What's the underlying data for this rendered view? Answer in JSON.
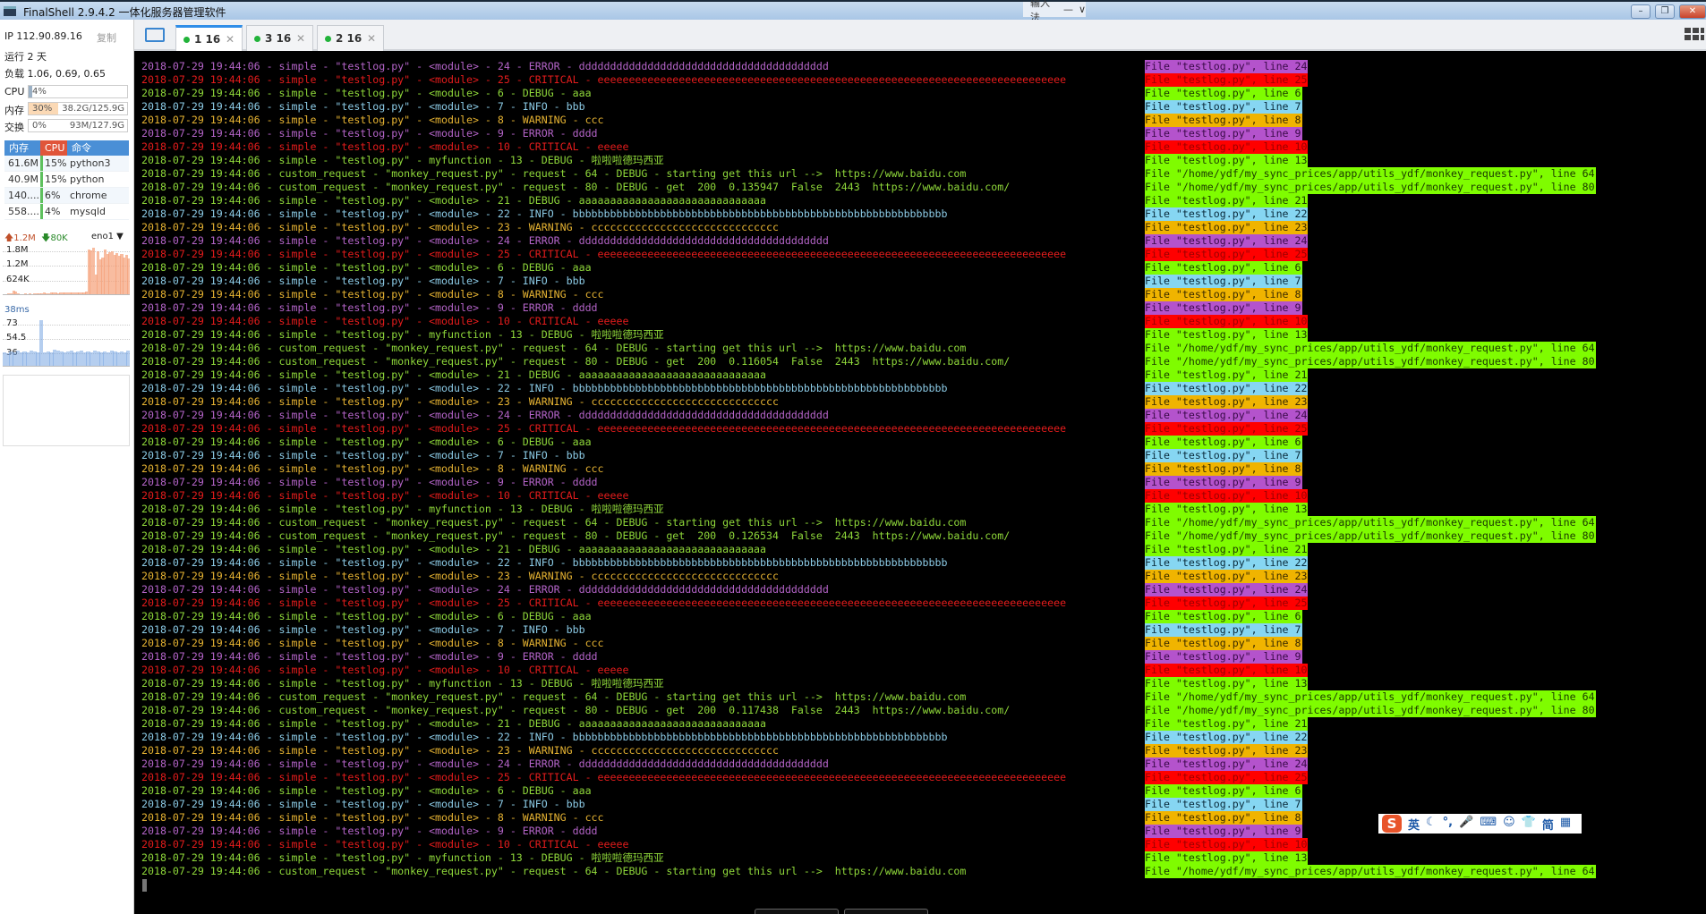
{
  "window": {
    "title": "FinalShell 2.9.4.2 一体化服务器管理软件",
    "controls": [
      "minimize",
      "restore",
      "close"
    ]
  },
  "floatbar": {
    "items": [
      "输入法",
      "—",
      "∨"
    ]
  },
  "tabs": [
    {
      "label": "1 16",
      "active": true,
      "status": "connected",
      "status_color": "#22b33a"
    },
    {
      "label": "3 16",
      "active": false,
      "status": "connected",
      "status_color": "#22b33a"
    },
    {
      "label": "2 16",
      "active": false,
      "status": "connected",
      "status_color": "#22b33a"
    }
  ],
  "sidebar": {
    "ip": "IP 112.90.89.16",
    "copy_label": "复制",
    "uptime": "运行 2 天",
    "load": "负载 1.06, 0.69, 0.65",
    "cpu": {
      "label": "CPU",
      "percent": "4%",
      "value": 4
    },
    "mem": {
      "label": "内存",
      "percent": "30%",
      "value": 30,
      "amount": "38.2G/125.9G"
    },
    "swap": {
      "label": "交换",
      "percent": "0%",
      "value": 0,
      "amount": "93M/127.9G"
    },
    "process_headers": [
      "内存",
      "CPU",
      "命令"
    ],
    "processes": [
      {
        "mem": "61.6M",
        "cpu": "15%",
        "cmd": "python3"
      },
      {
        "mem": "40.9M",
        "cpu": "15%",
        "cmd": "python"
      },
      {
        "mem": "140....",
        "cpu": "6%",
        "cmd": "chrome"
      },
      {
        "mem": "558....",
        "cpu": "4%",
        "cmd": "mysqld"
      }
    ],
    "network": {
      "up": "1.2M",
      "down": "80K",
      "interface": "eno1",
      "labels": [
        "1.8M",
        "1.2M",
        "624K"
      ],
      "history": [
        0,
        0,
        1,
        2,
        8,
        6,
        2,
        0,
        0,
        1,
        0,
        1,
        0,
        2,
        1,
        1,
        2,
        3,
        1,
        2,
        3,
        4,
        3,
        2,
        3,
        4,
        3,
        4,
        4,
        3,
        3,
        4,
        3,
        3,
        4,
        5,
        90,
        88,
        92,
        40,
        86,
        70,
        74,
        90,
        80,
        84,
        86,
        78,
        82,
        76,
        80,
        74,
        78,
        72
      ]
    },
    "ping": {
      "current": "38ms",
      "labels": [
        "73",
        "54.5",
        "36"
      ],
      "history": [
        36,
        35,
        37,
        36,
        38,
        36,
        37,
        36,
        38,
        37,
        36,
        75,
        36,
        37,
        36,
        39,
        38,
        37,
        36,
        37,
        38,
        36,
        37,
        38,
        36,
        37,
        36,
        38,
        37,
        36,
        37,
        36,
        38,
        37,
        36,
        37,
        36,
        38
      ]
    }
  },
  "levels": {
    "DEBUG": {
      "fg": "#8fd83a",
      "badge": "#7ffc00",
      "badge_fg": "#1a3a00"
    },
    "INFO": {
      "fg": "#8ccbe6",
      "badge": "#86d6f2",
      "badge_fg": "#0a2a3a"
    },
    "WARNING": {
      "fg": "#e6b332",
      "badge": "#f0b400",
      "badge_fg": "#3a2a00"
    },
    "ERROR": {
      "fg": "#b464c8",
      "badge": "#b453cc",
      "badge_fg": "#3a0a48"
    },
    "CRITICAL": {
      "fg": "#e41c1c",
      "badge": "#ff0000",
      "badge_fg": "#9a0000"
    }
  },
  "terminal": {
    "lines": [
      {
        "lvl": "ERROR",
        "text": "2018-07-29 19:44:06 - simple - \"testlog.py\" - <module> - 24 - ERROR - dddddddddddddddddddddddddddddddddddddddd",
        "file": "File \"testlog.py\", line 24"
      },
      {
        "lvl": "CRITICAL",
        "text": "2018-07-29 19:44:06 - simple - \"testlog.py\" - <module> - 25 - CRITICAL - eeeeeeeeeeeeeeeeeeeeeeeeeeeeeeeeeeeeeeeeeeeeeeeeeeeeeeeeeeeeeeeeeeeeeeeeeee",
        "file": "File \"testlog.py\", line 25"
      },
      {
        "lvl": "DEBUG",
        "text": "2018-07-29 19:44:06 - simple - \"testlog.py\" - <module> - 6 - DEBUG - aaa",
        "file": "File \"testlog.py\", line 6"
      },
      {
        "lvl": "INFO",
        "text": "2018-07-29 19:44:06 - simple - \"testlog.py\" - <module> - 7 - INFO - bbb",
        "file": "File \"testlog.py\", line 7"
      },
      {
        "lvl": "WARNING",
        "text": "2018-07-29 19:44:06 - simple - \"testlog.py\" - <module> - 8 - WARNING - ccc",
        "file": "File \"testlog.py\", line 8"
      },
      {
        "lvl": "ERROR",
        "text": "2018-07-29 19:44:06 - simple - \"testlog.py\" - <module> - 9 - ERROR - dddd",
        "file": "File \"testlog.py\", line 9"
      },
      {
        "lvl": "CRITICAL",
        "text": "2018-07-29 19:44:06 - simple - \"testlog.py\" - <module> - 10 - CRITICAL - eeeee",
        "file": "File \"testlog.py\", line 10"
      },
      {
        "lvl": "DEBUG",
        "text": "2018-07-29 19:44:06 - simple - \"testlog.py\" - myfunction - 13 - DEBUG - 啦啦啦德玛西亚",
        "file": "File \"testlog.py\", line 13"
      },
      {
        "lvl": "DEBUG",
        "text": "2018-07-29 19:44:06 - custom_request - \"monkey_request.py\" - request - 64 - DEBUG - starting get this url -->  https://www.baidu.com",
        "file": "File \"/home/ydf/my_sync_prices/app/utils_ydf/monkey_request.py\", line 64"
      },
      {
        "lvl": "DEBUG",
        "text": "2018-07-29 19:44:06 - custom_request - \"monkey_request.py\" - request - 80 - DEBUG - get  200  0.135947  False  2443  https://www.baidu.com/",
        "file": "File \"/home/ydf/my_sync_prices/app/utils_ydf/monkey_request.py\", line 80"
      },
      {
        "lvl": "DEBUG",
        "text": "2018-07-29 19:44:06 - simple - \"testlog.py\" - <module> - 21 - DEBUG - aaaaaaaaaaaaaaaaaaaaaaaaaaaaaa",
        "file": "File \"testlog.py\", line 21"
      },
      {
        "lvl": "INFO",
        "text": "2018-07-29 19:44:06 - simple - \"testlog.py\" - <module> - 22 - INFO - bbbbbbbbbbbbbbbbbbbbbbbbbbbbbbbbbbbbbbbbbbbbbbbbbbbbbbbbbbbb",
        "file": "File \"testlog.py\", line 22"
      },
      {
        "lvl": "WARNING",
        "text": "2018-07-29 19:44:06 - simple - \"testlog.py\" - <module> - 23 - WARNING - cccccccccccccccccccccccccccccc",
        "file": "File \"testlog.py\", line 23"
      },
      {
        "lvl": "ERROR",
        "text": "2018-07-29 19:44:06 - simple - \"testlog.py\" - <module> - 24 - ERROR - dddddddddddddddddddddddddddddddddddddddd",
        "file": "File \"testlog.py\", line 24"
      },
      {
        "lvl": "CRITICAL",
        "text": "2018-07-29 19:44:06 - simple - \"testlog.py\" - <module> - 25 - CRITICAL - eeeeeeeeeeeeeeeeeeeeeeeeeeeeeeeeeeeeeeeeeeeeeeeeeeeeeeeeeeeeeeeeeeeeeeeeeee",
        "file": "File \"testlog.py\", line 25"
      },
      {
        "lvl": "DEBUG",
        "text": "2018-07-29 19:44:06 - simple - \"testlog.py\" - <module> - 6 - DEBUG - aaa",
        "file": "File \"testlog.py\", line 6"
      },
      {
        "lvl": "INFO",
        "text": "2018-07-29 19:44:06 - simple - \"testlog.py\" - <module> - 7 - INFO - bbb",
        "file": "File \"testlog.py\", line 7"
      },
      {
        "lvl": "WARNING",
        "text": "2018-07-29 19:44:06 - simple - \"testlog.py\" - <module> - 8 - WARNING - ccc",
        "file": "File \"testlog.py\", line 8"
      },
      {
        "lvl": "ERROR",
        "text": "2018-07-29 19:44:06 - simple - \"testlog.py\" - <module> - 9 - ERROR - dddd",
        "file": "File \"testlog.py\", line 9"
      },
      {
        "lvl": "CRITICAL",
        "text": "2018-07-29 19:44:06 - simple - \"testlog.py\" - <module> - 10 - CRITICAL - eeeee",
        "file": "File \"testlog.py\", line 10"
      },
      {
        "lvl": "DEBUG",
        "text": "2018-07-29 19:44:06 - simple - \"testlog.py\" - myfunction - 13 - DEBUG - 啦啦啦德玛西亚",
        "file": "File \"testlog.py\", line 13"
      },
      {
        "lvl": "DEBUG",
        "text": "2018-07-29 19:44:06 - custom_request - \"monkey_request.py\" - request - 64 - DEBUG - starting get this url -->  https://www.baidu.com",
        "file": "File \"/home/ydf/my_sync_prices/app/utils_ydf/monkey_request.py\", line 64"
      },
      {
        "lvl": "DEBUG",
        "text": "2018-07-29 19:44:06 - custom_request - \"monkey_request.py\" - request - 80 - DEBUG - get  200  0.116054  False  2443  https://www.baidu.com/",
        "file": "File \"/home/ydf/my_sync_prices/app/utils_ydf/monkey_request.py\", line 80"
      },
      {
        "lvl": "DEBUG",
        "text": "2018-07-29 19:44:06 - simple - \"testlog.py\" - <module> - 21 - DEBUG - aaaaaaaaaaaaaaaaaaaaaaaaaaaaaa",
        "file": "File \"testlog.py\", line 21"
      },
      {
        "lvl": "INFO",
        "text": "2018-07-29 19:44:06 - simple - \"testlog.py\" - <module> - 22 - INFO - bbbbbbbbbbbbbbbbbbbbbbbbbbbbbbbbbbbbbbbbbbbbbbbbbbbbbbbbbbbb",
        "file": "File \"testlog.py\", line 22"
      },
      {
        "lvl": "WARNING",
        "text": "2018-07-29 19:44:06 - simple - \"testlog.py\" - <module> - 23 - WARNING - cccccccccccccccccccccccccccccc",
        "file": "File \"testlog.py\", line 23"
      },
      {
        "lvl": "ERROR",
        "text": "2018-07-29 19:44:06 - simple - \"testlog.py\" - <module> - 24 - ERROR - dddddddddddddddddddddddddddddddddddddddd",
        "file": "File \"testlog.py\", line 24"
      },
      {
        "lvl": "CRITICAL",
        "text": "2018-07-29 19:44:06 - simple - \"testlog.py\" - <module> - 25 - CRITICAL - eeeeeeeeeeeeeeeeeeeeeeeeeeeeeeeeeeeeeeeeeeeeeeeeeeeeeeeeeeeeeeeeeeeeeeeeeee",
        "file": "File \"testlog.py\", line 25"
      },
      {
        "lvl": "DEBUG",
        "text": "2018-07-29 19:44:06 - simple - \"testlog.py\" - <module> - 6 - DEBUG - aaa",
        "file": "File \"testlog.py\", line 6"
      },
      {
        "lvl": "INFO",
        "text": "2018-07-29 19:44:06 - simple - \"testlog.py\" - <module> - 7 - INFO - bbb",
        "file": "File \"testlog.py\", line 7"
      },
      {
        "lvl": "WARNING",
        "text": "2018-07-29 19:44:06 - simple - \"testlog.py\" - <module> - 8 - WARNING - ccc",
        "file": "File \"testlog.py\", line 8"
      },
      {
        "lvl": "ERROR",
        "text": "2018-07-29 19:44:06 - simple - \"testlog.py\" - <module> - 9 - ERROR - dddd",
        "file": "File \"testlog.py\", line 9"
      },
      {
        "lvl": "CRITICAL",
        "text": "2018-07-29 19:44:06 - simple - \"testlog.py\" - <module> - 10 - CRITICAL - eeeee",
        "file": "File \"testlog.py\", line 10"
      },
      {
        "lvl": "DEBUG",
        "text": "2018-07-29 19:44:06 - simple - \"testlog.py\" - myfunction - 13 - DEBUG - 啦啦啦德玛西亚",
        "file": "File \"testlog.py\", line 13"
      },
      {
        "lvl": "DEBUG",
        "text": "2018-07-29 19:44:06 - custom_request - \"monkey_request.py\" - request - 64 - DEBUG - starting get this url -->  https://www.baidu.com",
        "file": "File \"/home/ydf/my_sync_prices/app/utils_ydf/monkey_request.py\", line 64"
      },
      {
        "lvl": "DEBUG",
        "text": "2018-07-29 19:44:06 - custom_request - \"monkey_request.py\" - request - 80 - DEBUG - get  200  0.126534  False  2443  https://www.baidu.com/",
        "file": "File \"/home/ydf/my_sync_prices/app/utils_ydf/monkey_request.py\", line 80"
      },
      {
        "lvl": "DEBUG",
        "text": "2018-07-29 19:44:06 - simple - \"testlog.py\" - <module> - 21 - DEBUG - aaaaaaaaaaaaaaaaaaaaaaaaaaaaaa",
        "file": "File \"testlog.py\", line 21"
      },
      {
        "lvl": "INFO",
        "text": "2018-07-29 19:44:06 - simple - \"testlog.py\" - <module> - 22 - INFO - bbbbbbbbbbbbbbbbbbbbbbbbbbbbbbbbbbbbbbbbbbbbbbbbbbbbbbbbbbbb",
        "file": "File \"testlog.py\", line 22"
      },
      {
        "lvl": "WARNING",
        "text": "2018-07-29 19:44:06 - simple - \"testlog.py\" - <module> - 23 - WARNING - cccccccccccccccccccccccccccccc",
        "file": "File \"testlog.py\", line 23"
      },
      {
        "lvl": "ERROR",
        "text": "2018-07-29 19:44:06 - simple - \"testlog.py\" - <module> - 24 - ERROR - dddddddddddddddddddddddddddddddddddddddd",
        "file": "File \"testlog.py\", line 24"
      },
      {
        "lvl": "CRITICAL",
        "text": "2018-07-29 19:44:06 - simple - \"testlog.py\" - <module> - 25 - CRITICAL - eeeeeeeeeeeeeeeeeeeeeeeeeeeeeeeeeeeeeeeeeeeeeeeeeeeeeeeeeeeeeeeeeeeeeeeeeee",
        "file": "File \"testlog.py\", line 25"
      },
      {
        "lvl": "DEBUG",
        "text": "2018-07-29 19:44:06 - simple - \"testlog.py\" - <module> - 6 - DEBUG - aaa",
        "file": "File \"testlog.py\", line 6"
      },
      {
        "lvl": "INFO",
        "text": "2018-07-29 19:44:06 - simple - \"testlog.py\" - <module> - 7 - INFO - bbb",
        "file": "File \"testlog.py\", line 7"
      },
      {
        "lvl": "WARNING",
        "text": "2018-07-29 19:44:06 - simple - \"testlog.py\" - <module> - 8 - WARNING - ccc",
        "file": "File \"testlog.py\", line 8"
      },
      {
        "lvl": "ERROR",
        "text": "2018-07-29 19:44:06 - simple - \"testlog.py\" - <module> - 9 - ERROR - dddd",
        "file": "File \"testlog.py\", line 9"
      },
      {
        "lvl": "CRITICAL",
        "text": "2018-07-29 19:44:06 - simple - \"testlog.py\" - <module> - 10 - CRITICAL - eeeee",
        "file": "File \"testlog.py\", line 10"
      },
      {
        "lvl": "DEBUG",
        "text": "2018-07-29 19:44:06 - simple - \"testlog.py\" - myfunction - 13 - DEBUG - 啦啦啦德玛西亚",
        "file": "File \"testlog.py\", line 13"
      },
      {
        "lvl": "DEBUG",
        "text": "2018-07-29 19:44:06 - custom_request - \"monkey_request.py\" - request - 64 - DEBUG - starting get this url -->  https://www.baidu.com",
        "file": "File \"/home/ydf/my_sync_prices/app/utils_ydf/monkey_request.py\", line 64"
      },
      {
        "lvl": "DEBUG",
        "text": "2018-07-29 19:44:06 - custom_request - \"monkey_request.py\" - request - 80 - DEBUG - get  200  0.117438  False  2443  https://www.baidu.com/",
        "file": "File \"/home/ydf/my_sync_prices/app/utils_ydf/monkey_request.py\", line 80"
      },
      {
        "lvl": "DEBUG",
        "text": "2018-07-29 19:44:06 - simple - \"testlog.py\" - <module> - 21 - DEBUG - aaaaaaaaaaaaaaaaaaaaaaaaaaaaaa",
        "file": "File \"testlog.py\", line 21"
      },
      {
        "lvl": "INFO",
        "text": "2018-07-29 19:44:06 - simple - \"testlog.py\" - <module> - 22 - INFO - bbbbbbbbbbbbbbbbbbbbbbbbbbbbbbbbbbbbbbbbbbbbbbbbbbbbbbbbbbbb",
        "file": "File \"testlog.py\", line 22"
      },
      {
        "lvl": "WARNING",
        "text": "2018-07-29 19:44:06 - simple - \"testlog.py\" - <module> - 23 - WARNING - cccccccccccccccccccccccccccccc",
        "file": "File \"testlog.py\", line 23"
      },
      {
        "lvl": "ERROR",
        "text": "2018-07-29 19:44:06 - simple - \"testlog.py\" - <module> - 24 - ERROR - dddddddddddddddddddddddddddddddddddddddd",
        "file": "File \"testlog.py\", line 24"
      },
      {
        "lvl": "CRITICAL",
        "text": "2018-07-29 19:44:06 - simple - \"testlog.py\" - <module> - 25 - CRITICAL - eeeeeeeeeeeeeeeeeeeeeeeeeeeeeeeeeeeeeeeeeeeeeeeeeeeeeeeeeeeeeeeeeeeeeeeeeee",
        "file": "File \"testlog.py\", line 25"
      },
      {
        "lvl": "DEBUG",
        "text": "2018-07-29 19:44:06 - simple - \"testlog.py\" - <module> - 6 - DEBUG - aaa",
        "file": "File \"testlog.py\", line 6"
      },
      {
        "lvl": "INFO",
        "text": "2018-07-29 19:44:06 - simple - \"testlog.py\" - <module> - 7 - INFO - bbb",
        "file": "File \"testlog.py\", line 7"
      },
      {
        "lvl": "WARNING",
        "text": "2018-07-29 19:44:06 - simple - \"testlog.py\" - <module> - 8 - WARNING - ccc",
        "file": "File \"testlog.py\", line 8"
      },
      {
        "lvl": "ERROR",
        "text": "2018-07-29 19:44:06 - simple - \"testlog.py\" - <module> - 9 - ERROR - dddd",
        "file": "File \"testlog.py\", line 9"
      },
      {
        "lvl": "CRITICAL",
        "text": "2018-07-29 19:44:06 - simple - \"testlog.py\" - <module> - 10 - CRITICAL - eeeee",
        "file": "File \"testlog.py\", line 10"
      },
      {
        "lvl": "DEBUG",
        "text": "2018-07-29 19:44:06 - simple - \"testlog.py\" - myfunction - 13 - DEBUG - 啦啦啦德玛西亚",
        "file": "File \"testlog.py\", line 13"
      },
      {
        "lvl": "DEBUG",
        "text": "2018-07-29 19:44:06 - custom_request - \"monkey_request.py\" - request - 64 - DEBUG - starting get this url -->  https://www.baidu.com",
        "file": "File \"/home/ydf/my_sync_prices/app/utils_ydf/monkey_request.py\", line 64"
      }
    ]
  },
  "ime": {
    "logo": "S",
    "items": [
      "英",
      "☾",
      "°,",
      "🎤",
      "⌨",
      "☺",
      "👕",
      "简",
      "▦"
    ]
  }
}
